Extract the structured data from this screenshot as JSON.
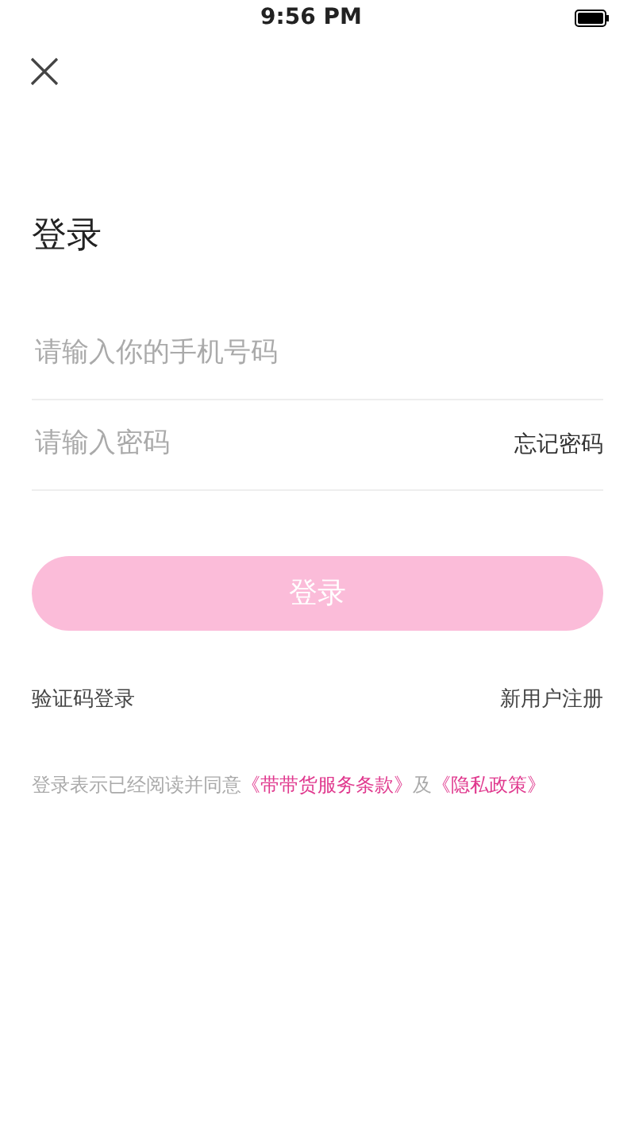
{
  "status_bar": {
    "time": "9:56 PM"
  },
  "title": "登录",
  "fields": [
    {
      "placeholder": "请输入你的手机号码"
    },
    {
      "placeholder": "请输入密码",
      "action": "忘记密码"
    }
  ],
  "login_button": {
    "label": "登录",
    "disabled": true
  },
  "links": {
    "left": "验证码登录",
    "right": "新用户注册"
  },
  "agreement": [
    {
      "kind": "text",
      "text": "登录表示已经阅读并同意"
    },
    {
      "kind": "link",
      "text": "《带带货服务条款》"
    },
    {
      "kind": "text",
      "text": "及"
    },
    {
      "kind": "link",
      "text": "《隐私政策》"
    }
  ]
}
